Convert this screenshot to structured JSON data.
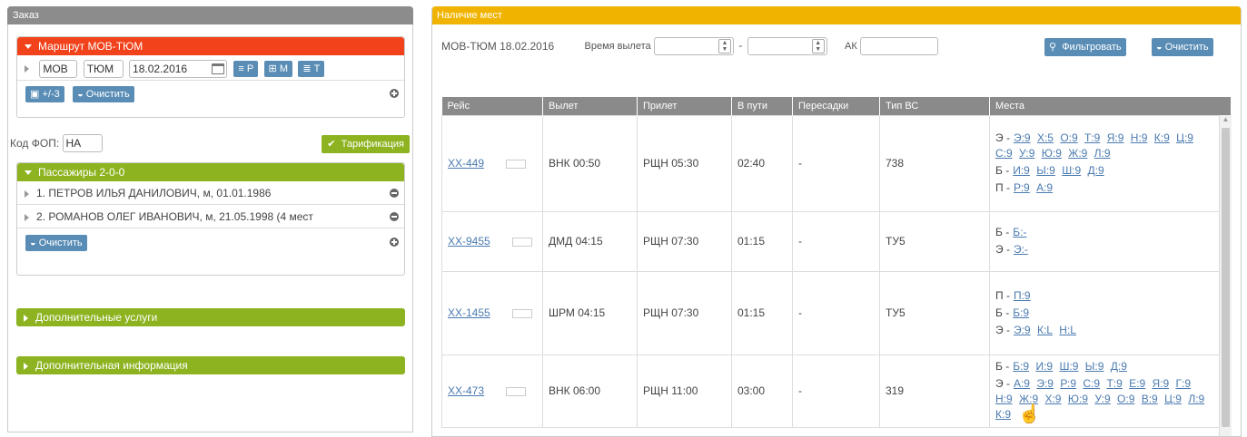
{
  "order": {
    "title": "Заказ",
    "route": {
      "header": "Маршрут МОВ-ТЮМ",
      "from": "МОВ",
      "to": "ТЮМ",
      "date": "18.02.2016",
      "btn_r": "Р",
      "btn_m": "М",
      "btn_t": "Т",
      "btn_pm3": "+/-3",
      "btn_clear": "Очистить"
    },
    "fop_label": "Код ФОП:",
    "fop_value": "НА",
    "tarif_label": "Тарификация",
    "passengers": {
      "header": "Пассажиры 2-0-0",
      "items": [
        "1. ПЕТРОВ ИЛЬЯ ДАНИЛОВИЧ, м, 01.01.1986",
        "2. РОМАНОВ ОЛЕГ ИВАНОВИЧ, м, 21.05.1998 (4 мест"
      ],
      "clear_label": "Очистить"
    },
    "extra_services": "Дополнительные услуги",
    "extra_info": "Дополнительная информация"
  },
  "avail": {
    "title": "Наличие мест",
    "route_date": "МОВ-ТЮМ 18.02.2016",
    "dep_time_label": "Время вылета",
    "dash": "-",
    "ak_label": "АК",
    "filter_label": "Фильтровать",
    "clear_label": "Очистить",
    "columns": [
      "Рейс",
      "Вылет",
      "Прилет",
      "В пути",
      "Пересадки",
      "Тип ВС",
      "Места"
    ],
    "rows": [
      {
        "flight": "ХХ-449",
        "dep": "ВНК 00:50",
        "arr": "РЩН 05:30",
        "dur": "02:40",
        "trans": "-",
        "ac": "738",
        "seats": [
          {
            "cls": "Э -",
            "links": [
              "Э:9",
              "Х:5",
              "О:9",
              "Т:9",
              "Я:9",
              "Н:9",
              "К:9",
              "Ц:9",
              "С:9",
              "У:9",
              "Ю:9",
              "Ж:9",
              "Л:9"
            ]
          },
          {
            "cls": "Б -",
            "links": [
              "И:9",
              "Ы:9",
              "Ш:9",
              "Д:9"
            ]
          },
          {
            "cls": "П -",
            "links": [
              "Р:9",
              "А:9"
            ]
          }
        ]
      },
      {
        "flight": "ХХ-9455",
        "dep": "ДМД 04:15",
        "arr": "РЩН 07:30",
        "dur": "01:15",
        "trans": "-",
        "ac": "ТУ5",
        "seats": [
          {
            "cls": "Б -",
            "links": [
              "Б:-"
            ]
          },
          {
            "cls": "Э -",
            "links": [
              "Э:-"
            ]
          }
        ]
      },
      {
        "flight": "ХХ-1455",
        "dep": "ШРМ 04:15",
        "arr": "РЩН 07:30",
        "dur": "01:15",
        "trans": "-",
        "ac": "ТУ5",
        "seats": [
          {
            "cls": "П -",
            "links": [
              "П:9"
            ]
          },
          {
            "cls": "Б -",
            "links": [
              "Б:9"
            ]
          },
          {
            "cls": "Э -",
            "links": [
              "Э:9",
              "К:L",
              "Н:L"
            ]
          }
        ]
      },
      {
        "flight": "ХХ-473",
        "dep": "ВНК 06:00",
        "arr": "РЩН 11:00",
        "dur": "03:00",
        "trans": "-",
        "ac": "319",
        "seats": [
          {
            "cls": "Б -",
            "links": [
              "Б:9",
              "И:9",
              "Ш:9",
              "Ы:9",
              "Д:9"
            ]
          },
          {
            "cls": "Э -",
            "links": [
              "А:9",
              "Э:9",
              "Р:9",
              "С:9",
              "Т:9",
              "Е:9",
              "Я:9",
              "Г:9",
              "Н:9",
              "Ж:9",
              "Х:9",
              "Ю:9",
              "У:9",
              "О:9",
              "В:9",
              "Ц:9",
              "Л:9",
              "К:9"
            ]
          }
        ]
      }
    ]
  },
  "colors": {
    "panel_grey": "#8c8c8c",
    "panel_yellow": "#f0b400",
    "route_red": "#f2421b",
    "green": "#8db320",
    "blue_btn": "#5a8db6",
    "link": "#4a7ab0"
  }
}
